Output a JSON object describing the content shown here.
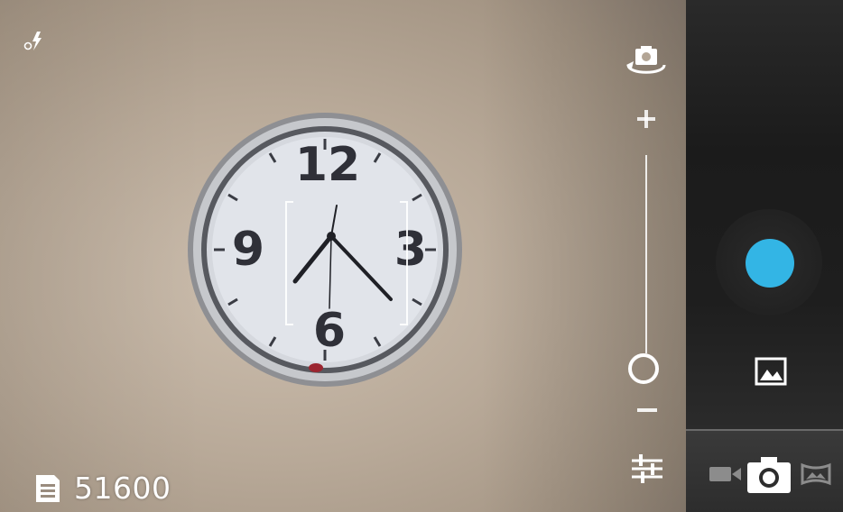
{
  "app": {
    "name": "Camera"
  },
  "viewfinder": {
    "clock_numerals": [
      "12",
      "3",
      "6",
      "9"
    ]
  },
  "storage": {
    "icon": "sd-card-icon",
    "remaining_pictures": "51600"
  },
  "controls": {
    "flash_icon": "flash-auto-icon",
    "switch_camera_icon": "switch-camera-icon",
    "zoom_plus": "+",
    "zoom_level": 0.0,
    "settings_icon": "settings-sliders-icon",
    "shutter_color": "#33b5e5",
    "gallery_icon": "gallery-thumbnail-icon"
  },
  "modes": {
    "items": [
      "video-icon",
      "camera-icon",
      "panorama-icon"
    ],
    "selected": "camera-icon"
  }
}
